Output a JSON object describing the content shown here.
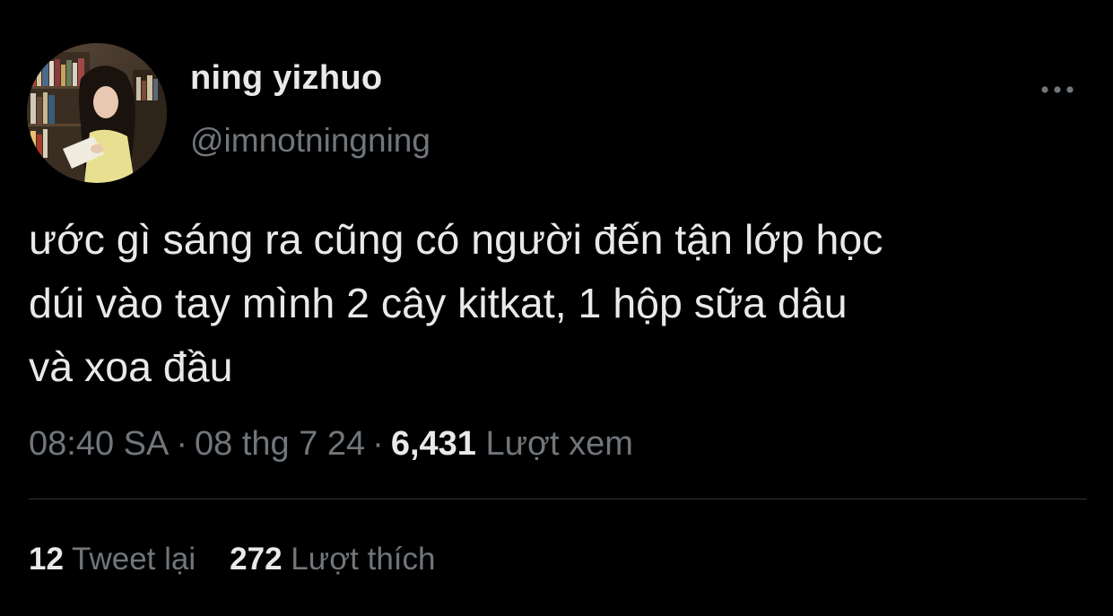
{
  "author": {
    "display_name": "ning yizhuo",
    "handle": "@imnotningning"
  },
  "tweet": {
    "lines": [
      "ước gì sáng ra cũng có người đến tận lớp học",
      "dúi vào tay mình 2 cây kitkat, 1 hộp sữa dâu",
      "và xoa đầu"
    ]
  },
  "meta": {
    "time": "08:40 SA",
    "separator": "·",
    "date": "08 thg 7 24",
    "views_count": "6,431",
    "views_label": "Lượt xem"
  },
  "stats": {
    "retweets_count": "12",
    "retweets_label": "Tweet lại",
    "likes_count": "272",
    "likes_label": "Lượt thích"
  },
  "icons": {
    "more": "more-horizontal-icon"
  },
  "colors": {
    "background": "#000000",
    "primary_text": "#e7e9ea",
    "secondary_text": "#71767b",
    "divider": "#2f3336"
  }
}
